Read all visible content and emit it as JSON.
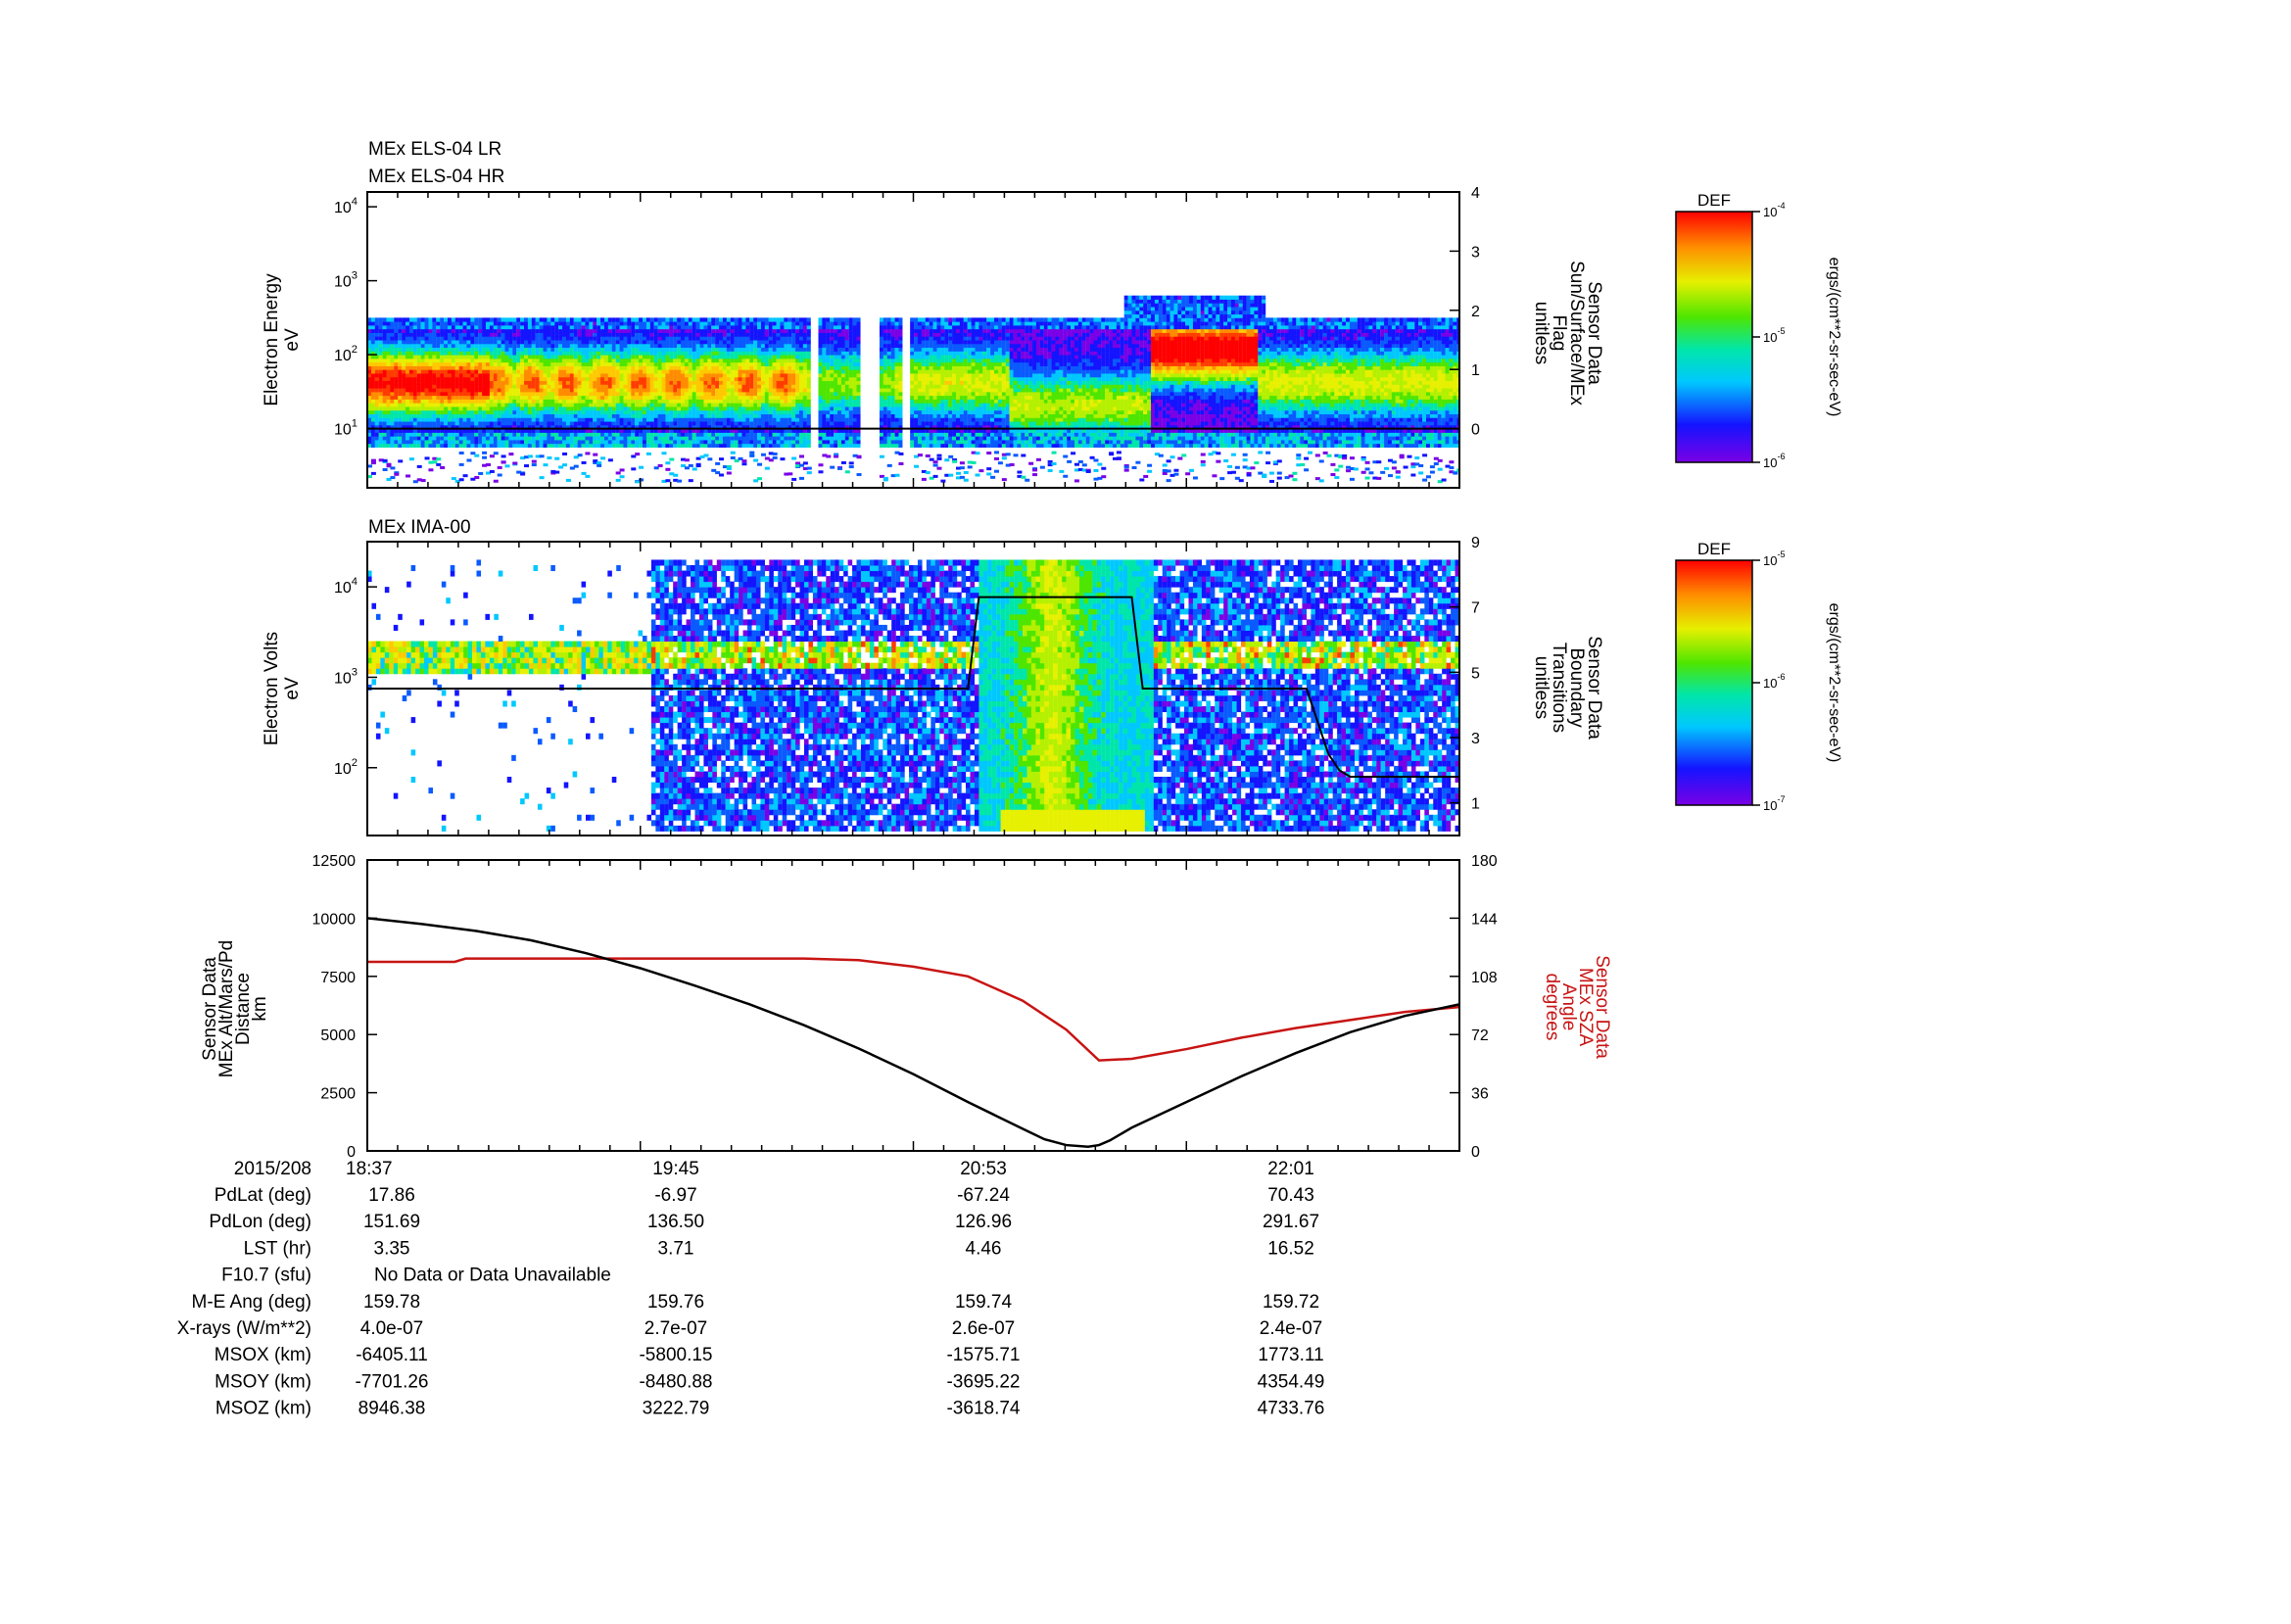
{
  "chart_data": [
    {
      "type": "heatmap",
      "titles": [
        "MEx ELS-04 LR",
        "MEx ELS-04 HR"
      ],
      "ylabel": [
        "Electron Energy",
        "eV"
      ],
      "y_scale": "log",
      "y_ticks": [
        "10^1",
        "10^2",
        "10^3",
        "10^4"
      ],
      "y2label": [
        "Sensor Data",
        "Sun/Surface/MEx",
        "Flag",
        "unitless"
      ],
      "y2_ticks": [
        "0",
        "1",
        "2",
        "3",
        "4"
      ],
      "y2lim": [
        -1,
        4
      ],
      "overlay_line": {
        "x": [
          0,
          100
        ],
        "y": [
          0,
          0
        ]
      },
      "colorbar": {
        "title": "DEF",
        "ticks": [
          "10^-4",
          "10^-5",
          "10^-6"
        ],
        "label": "ergs/(cm**2-sr-sec-eV)"
      }
    },
    {
      "type": "heatmap",
      "titles": [
        "MEx IMA-00"
      ],
      "ylabel": [
        "Electron Volts",
        "eV"
      ],
      "y_scale": "log",
      "y_ticks": [
        "10^2",
        "10^3",
        "10^4"
      ],
      "y2label": [
        "Sensor Data",
        "Boundary",
        "Transitions",
        "unitless"
      ],
      "y2_ticks": [
        "1",
        "3",
        "5",
        "7",
        "9"
      ],
      "y2lim": [
        0,
        9
      ],
      "overlay_line": {
        "x": [
          0,
          55,
          56,
          70,
          71,
          86,
          87,
          88,
          89,
          90,
          91,
          100
        ],
        "y": [
          4.5,
          4.5,
          7.3,
          7.3,
          4.5,
          4.5,
          3.5,
          2.5,
          2.0,
          1.8,
          1.8,
          1.8
        ]
      },
      "colorbar": {
        "title": "DEF",
        "ticks": [
          "10^-5",
          "10^-6",
          "10^-7"
        ],
        "label": "ergs/(cm**2-sr-sec-eV)"
      }
    },
    {
      "type": "line",
      "ylabel": [
        "Sensor Data",
        "MEx Alt/Mars/Pd",
        "Distance",
        "km"
      ],
      "ylim": [
        0,
        12500
      ],
      "y_ticks": [
        "0",
        "2500",
        "5000",
        "7500",
        "10000",
        "12500"
      ],
      "y2label": [
        "Sensor Data",
        "MEx SZA",
        "Angle",
        "degrees"
      ],
      "y2lim": [
        0,
        180
      ],
      "y2_ticks": [
        "0",
        "36",
        "72",
        "108",
        "144",
        "180"
      ],
      "series": [
        {
          "axis": "left",
          "color": "#000000",
          "x": [
            0,
            5,
            10,
            15,
            20,
            25,
            30,
            35,
            40,
            45,
            50,
            55,
            60,
            62,
            64,
            66,
            67,
            68,
            70,
            75,
            80,
            85,
            90,
            95,
            100
          ],
          "y": [
            10000,
            9750,
            9450,
            9050,
            8500,
            7850,
            7100,
            6300,
            5400,
            4400,
            3300,
            2100,
            950,
            500,
            250,
            180,
            250,
            450,
            1000,
            2100,
            3200,
            4200,
            5100,
            5800,
            6300
          ]
        },
        {
          "axis": "right",
          "color": "#c81414",
          "x": [
            0,
            8,
            9,
            40,
            45,
            50,
            55,
            60,
            64,
            67,
            70,
            75,
            80,
            85,
            90,
            95,
            100
          ],
          "y": [
            117,
            117,
            119,
            119,
            118,
            114,
            108,
            93,
            75,
            56,
            57,
            63,
            70,
            76,
            81,
            86,
            89
          ]
        }
      ]
    }
  ],
  "time_axis": {
    "ticks": [
      "18:37",
      "19:45",
      "20:53",
      "22:01"
    ],
    "date": "2015/208"
  },
  "ephemeris": [
    {
      "label": "PdLat (deg)",
      "values": [
        "17.86",
        "-6.97",
        "-67.24",
        "70.43"
      ]
    },
    {
      "label": "PdLon (deg)",
      "values": [
        "151.69",
        "136.50",
        "126.96",
        "291.67"
      ]
    },
    {
      "label": "LST (hr)",
      "values": [
        "3.35",
        "3.71",
        "4.46",
        "16.52"
      ]
    },
    {
      "label": "F10.7 (sfu)",
      "note": "No Data or Data Unavailable"
    },
    {
      "label": "M-E Ang (deg)",
      "values": [
        "159.78",
        "159.76",
        "159.74",
        "159.72"
      ]
    },
    {
      "label": "X-rays (W/m**2)",
      "values": [
        "4.0e-07",
        "2.7e-07",
        "2.6e-07",
        "2.4e-07"
      ]
    },
    {
      "label": "MSOX (km)",
      "values": [
        "-6405.11",
        "-5800.15",
        "-1575.71",
        "1773.11"
      ]
    },
    {
      "label": "MSOY (km)",
      "values": [
        "-7701.26",
        "-8480.88",
        "-3695.22",
        "4354.49"
      ]
    },
    {
      "label": "MSOZ (km)",
      "values": [
        "8946.38",
        "3222.79",
        "-3618.74",
        "4733.76"
      ]
    }
  ]
}
